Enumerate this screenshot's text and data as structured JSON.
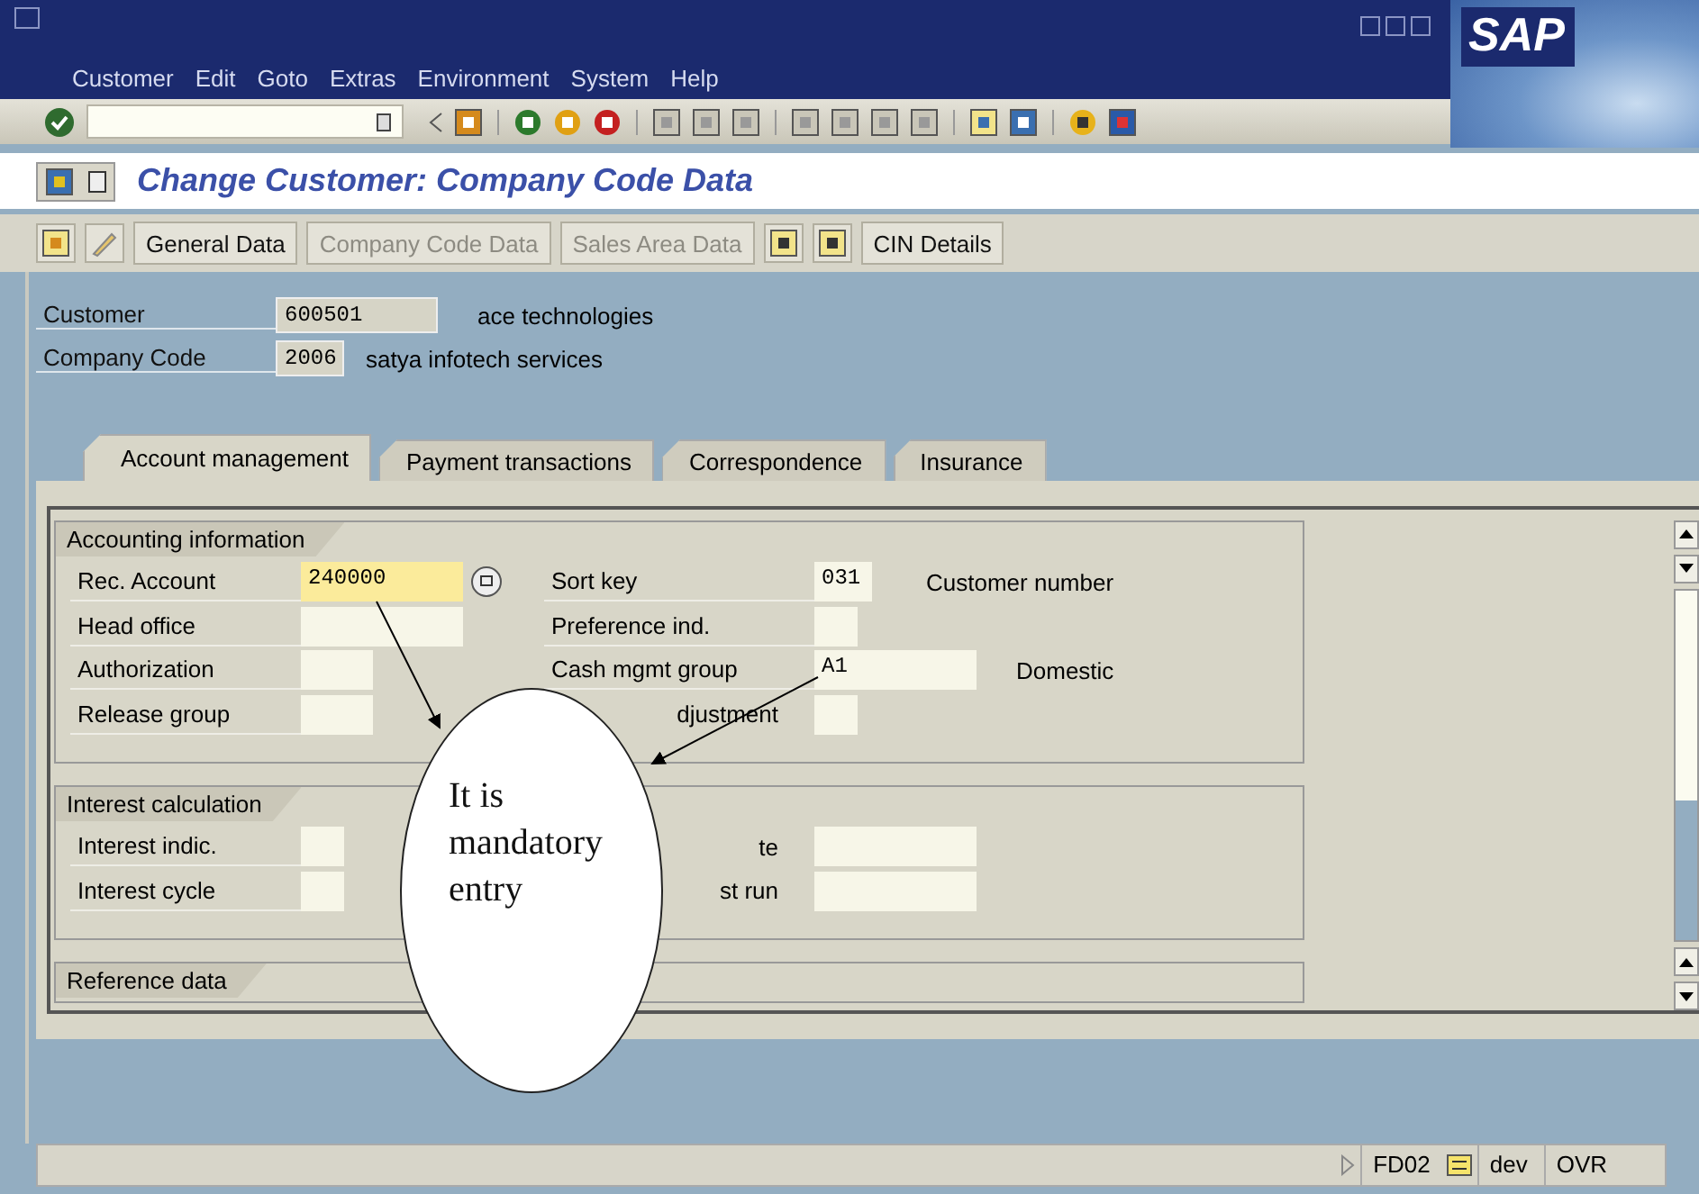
{
  "menu_bar": [
    "Customer",
    "Edit",
    "Goto",
    "Extras",
    "Environment",
    "System",
    "Help"
  ],
  "logo": "SAP",
  "title": "Change Customer: Company Code Data",
  "app_toolbar": [
    {
      "label": "General Data",
      "disabled": false
    },
    {
      "label": "Company Code Data",
      "disabled": true
    },
    {
      "label": "Sales Area Data",
      "disabled": true
    },
    {
      "label": "CIN Details",
      "disabled": false
    }
  ],
  "header": [
    {
      "label": "Customer",
      "value": "600501",
      "description": "ace technologies"
    },
    {
      "label": "Company Code",
      "value": "2006",
      "description": "satya infotech  services"
    }
  ],
  "tabs": [
    {
      "label": "Account management",
      "selected": true
    },
    {
      "label": "Payment transactions",
      "selected": false
    },
    {
      "label": "Correspondence",
      "selected": false
    },
    {
      "label": "Insurance",
      "selected": false
    }
  ],
  "sections": [
    {
      "title": "Accounting information",
      "rows": [
        {
          "left": {
            "label": "Rec. Account",
            "value": "240000",
            "focused": true
          },
          "right": {
            "label": "Sort key",
            "value": "031",
            "description": "Customer number",
            "covered": false
          }
        },
        {
          "left": {
            "label": "Head office",
            "focused": false
          },
          "right": {
            "label": "Preference ind.",
            "covered": false
          }
        },
        {
          "left": {
            "label": "Authorization",
            "focused": false
          },
          "right": {
            "label": "Cash mgmt group",
            "value": "A1",
            "description": "Domestic",
            "covered": false
          }
        },
        {
          "left": {
            "label": "Release group",
            "focused": false
          },
          "right": {
            "label": "djustment",
            "covered": true
          }
        }
      ]
    },
    {
      "title": "Interest calculation",
      "rows": [
        {
          "left": {
            "label": "Interest indic.",
            "focused": false
          },
          "right": {
            "label": "te",
            "covered": true
          }
        },
        {
          "left": {
            "label": "Interest cycle",
            "focused": false
          },
          "right": {
            "label": "st run",
            "covered": true
          }
        }
      ]
    },
    {
      "title": "Reference data"
    }
  ],
  "callout": {
    "text": "It is mandatory entry"
  },
  "status_bar": {
    "transaction": "FD02",
    "system": "dev",
    "mode": "OVR"
  }
}
